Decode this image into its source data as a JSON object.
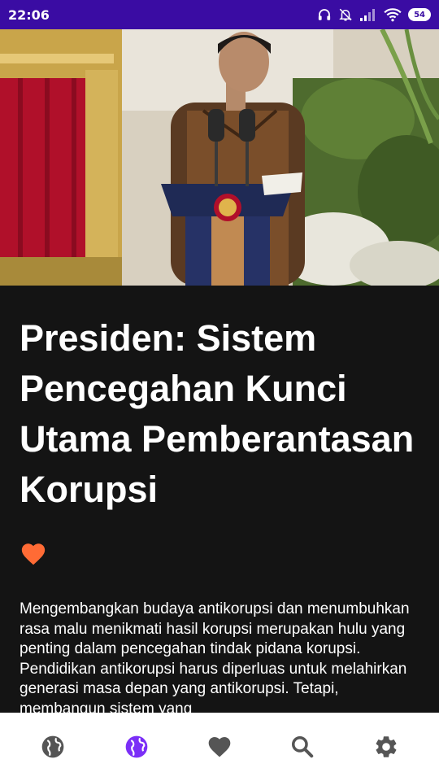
{
  "status_bar": {
    "time": "22:06",
    "battery": "54",
    "icons": [
      "headphones-icon",
      "bell-off-icon",
      "signal-icon",
      "wifi-icon",
      "battery-icon"
    ],
    "background": "#3a0ca3"
  },
  "article": {
    "headline": "Presiden: Sistem Pencegahan Kunci Utama Pemberantasan Korupsi",
    "favorite_icon": "heart-icon",
    "favorite_color": "#ff6b35",
    "body": "Mengembangkan budaya antikorupsi dan menumbuhkan rasa malu menikmati hasil korupsi merupakan hulu yang penting dalam pencegahan tindak pidana korupsi. Pendidikan antikorupsi harus diperluas untuk melahirkan generasi masa depan yang antikorupsi. Tetapi, membangun sistem yang"
  },
  "bottom_nav": {
    "items": [
      {
        "icon": "globe-icon",
        "active": false
      },
      {
        "icon": "globe-icon",
        "active": true
      },
      {
        "icon": "heart-icon",
        "active": false
      },
      {
        "icon": "search-icon",
        "active": false
      },
      {
        "icon": "gear-icon",
        "active": false
      }
    ],
    "active_color": "#7b2ff7",
    "inactive_color": "#555555"
  }
}
